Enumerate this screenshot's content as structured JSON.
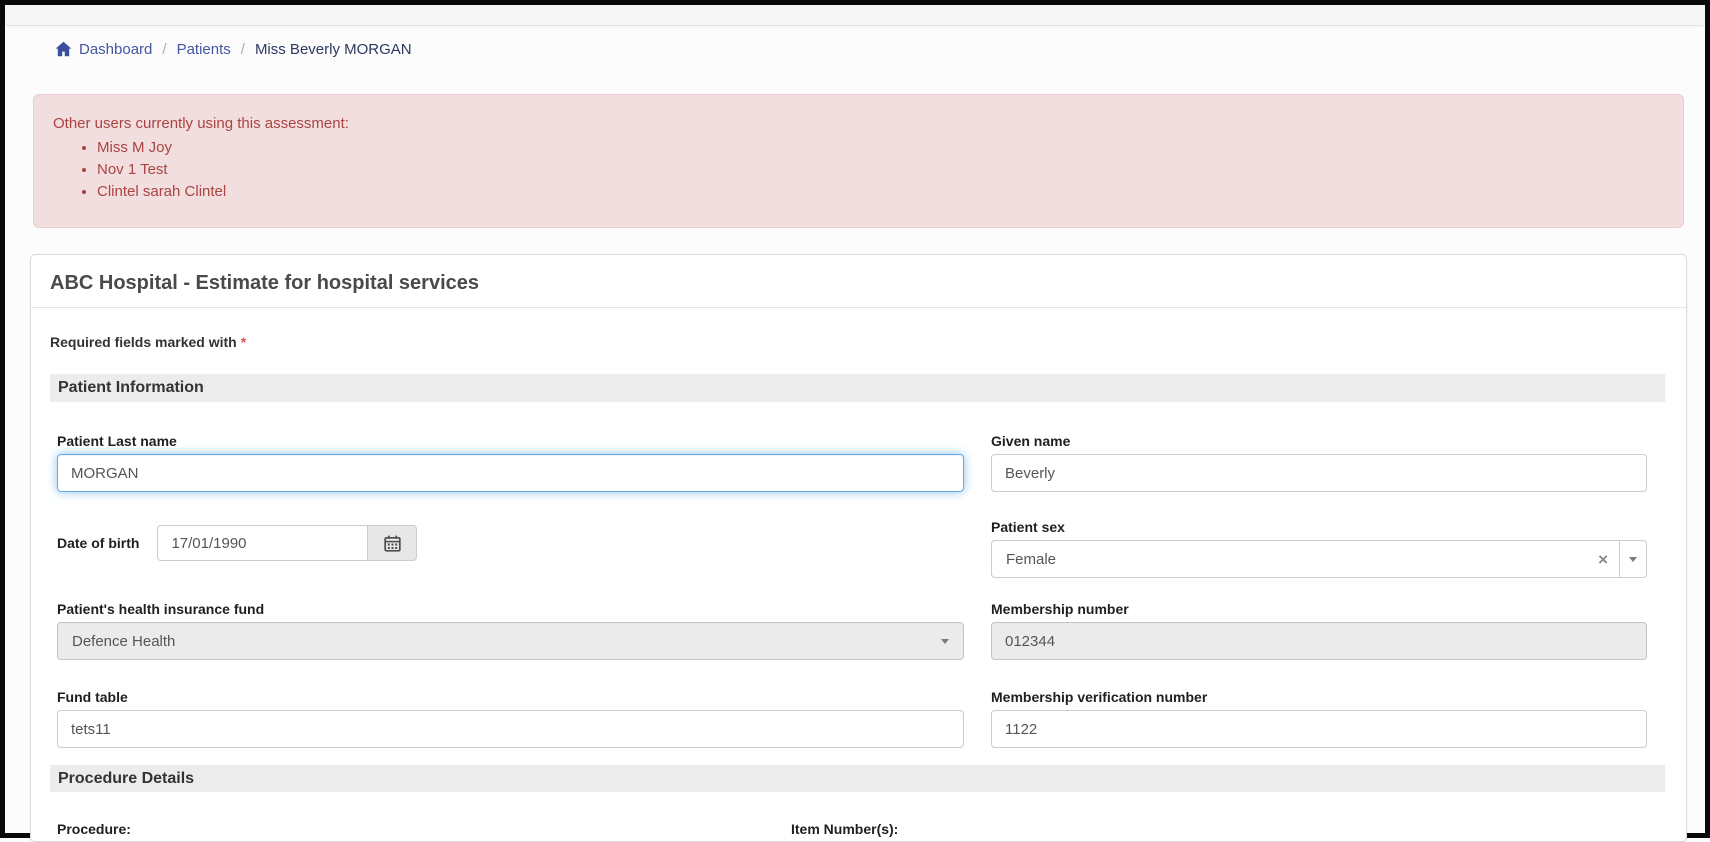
{
  "breadcrumb": {
    "separator": "/",
    "items": [
      {
        "label": "Dashboard"
      },
      {
        "label": "Patients"
      },
      {
        "label": "Miss Beverly MORGAN"
      }
    ]
  },
  "alert": {
    "title": "Other users currently using this assessment:",
    "users": [
      "Miss M Joy",
      "Nov 1 Test",
      "Clintel sarah Clintel"
    ]
  },
  "panel": {
    "title": "ABC Hospital - Estimate for hospital services",
    "required_note": "Required fields marked with",
    "required_marker": "*",
    "section_patient": "Patient Information",
    "section_procedure": "Procedure Details",
    "procedure_label": "Procedure:",
    "item_numbers_label": "Item Number(s):"
  },
  "fields": {
    "patient_last_name": {
      "label": "Patient Last name",
      "value": "MORGAN"
    },
    "given_name": {
      "label": "Given name",
      "value": "Beverly"
    },
    "date_of_birth": {
      "label": "Date of birth",
      "value": "17/01/1990"
    },
    "patient_sex": {
      "label": "Patient sex",
      "value": "Female",
      "clear_glyph": "×"
    },
    "health_fund": {
      "label": "Patient's health insurance fund",
      "value": "Defence Health"
    },
    "membership_number": {
      "label": "Membership number",
      "value": "012344"
    },
    "fund_table": {
      "label": "Fund table",
      "value": "tets11"
    },
    "membership_verification": {
      "label": "Membership verification number",
      "value": "1122"
    }
  },
  "icons": {
    "breadcrumb_home": "home-icon",
    "date_picker": "calendar-icon",
    "patient_sex_clear": "clear-x-icon",
    "patient_sex_caret": "caret-down-icon",
    "health_fund_caret": "caret-down-icon"
  },
  "colors": {
    "alert_bg": "#f2dede",
    "alert_border": "#ebccd1",
    "alert_text": "#a94442",
    "link_blue": "#4356a2",
    "active_crumb": "#2c3863",
    "required_red": "#d9534f",
    "focus_blue": "#63ace8",
    "section_bar_bg": "#ececec",
    "disabled_bg": "#ebebeb"
  }
}
